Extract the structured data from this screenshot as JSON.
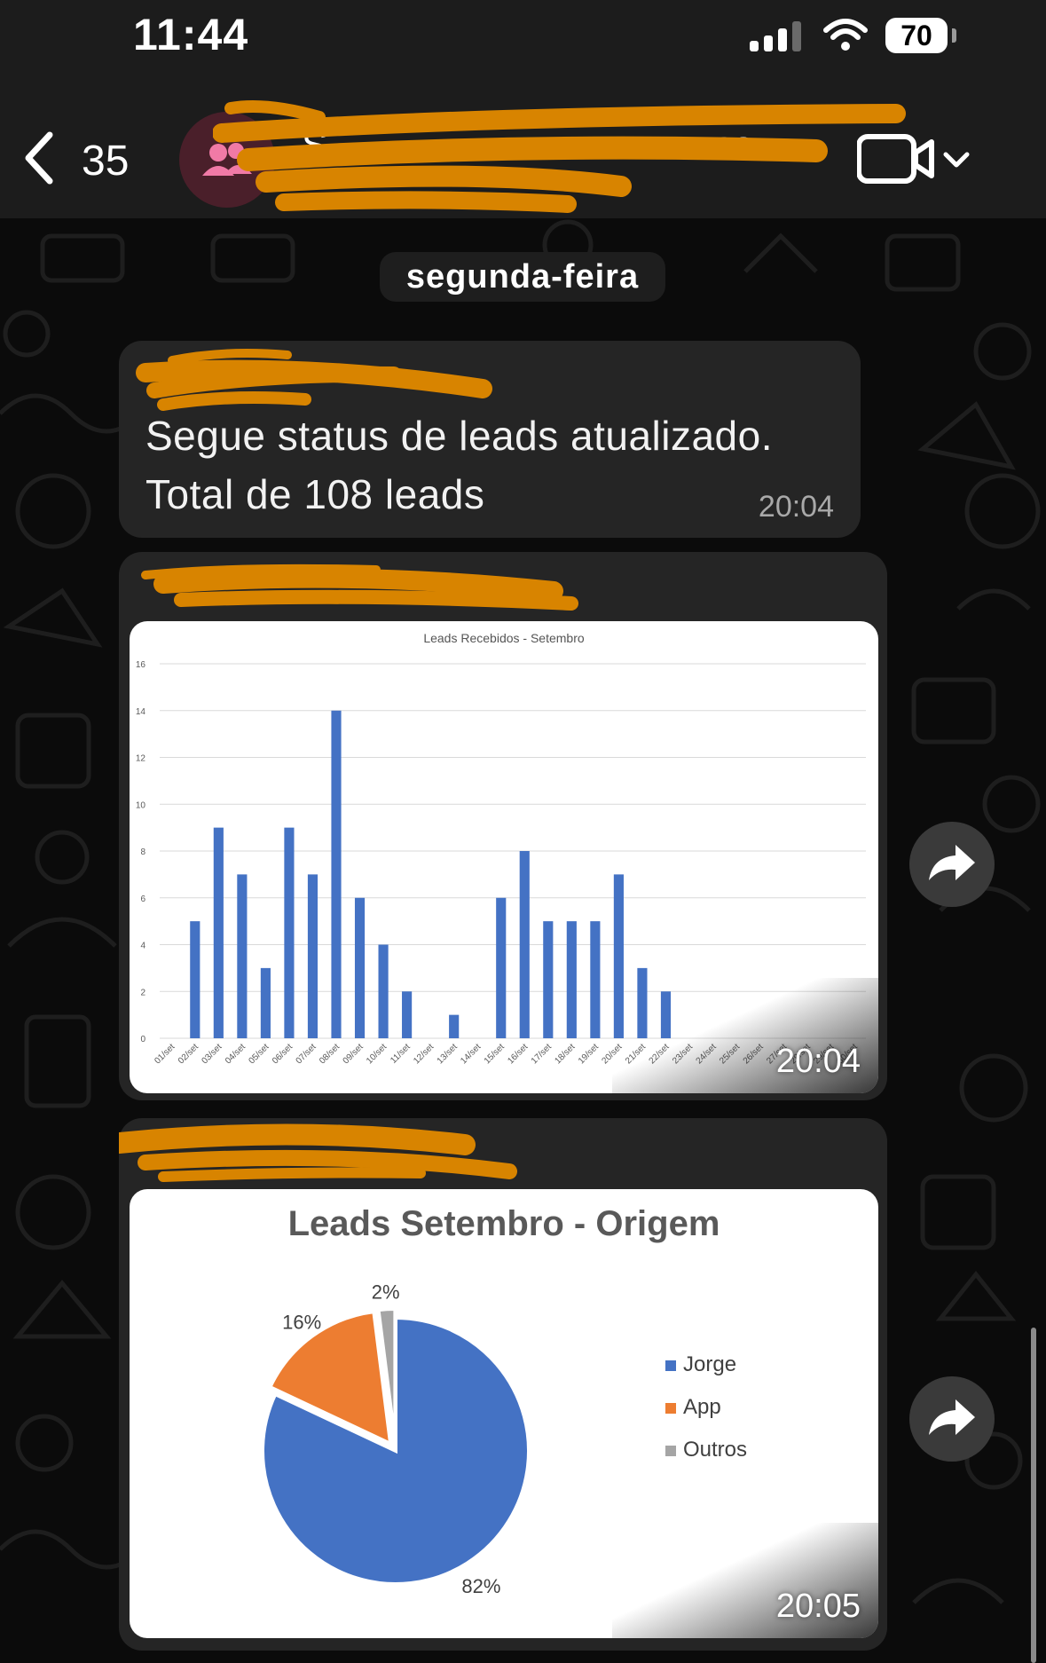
{
  "status_bar": {
    "time": "11:44",
    "battery": "70"
  },
  "header": {
    "back_count": "35"
  },
  "date_divider": "segunda-feira",
  "messages": [
    {
      "lines": [
        "Segue status de leads atualizado.",
        "Total de 108 leads"
      ],
      "time": "20:04"
    },
    {
      "time": "20:04"
    },
    {
      "time": "20:05"
    }
  ],
  "chart_data": [
    {
      "type": "bar",
      "title": "Leads Recebidos - Setembro",
      "categories": [
        "01/set",
        "02/set",
        "03/set",
        "04/set",
        "05/set",
        "06/set",
        "07/set",
        "08/set",
        "09/set",
        "10/set",
        "11/set",
        "12/set",
        "13/set",
        "14/set",
        "15/set",
        "16/set",
        "17/set",
        "18/set",
        "19/set",
        "20/set",
        "21/set",
        "22/set",
        "23/set",
        "24/set",
        "25/set",
        "26/set",
        "27/set",
        "28/set",
        "29/set",
        "30/set"
      ],
      "values": [
        0,
        5,
        9,
        7,
        3,
        9,
        7,
        14,
        6,
        4,
        2,
        0,
        1,
        0,
        6,
        8,
        5,
        5,
        5,
        7,
        3,
        2,
        0,
        0,
        0,
        0,
        0,
        0,
        0,
        0
      ],
      "ylim": [
        0,
        16
      ],
      "yticks": [
        0,
        2,
        4,
        6,
        8,
        10,
        12,
        14,
        16
      ],
      "grid": true,
      "colors": {
        "bar": "#4472C4"
      }
    },
    {
      "type": "pie",
      "title": "Leads Setembro - Origem",
      "slices": [
        {
          "label": "Jorge",
          "value": 82,
          "text": "82%",
          "color": "#4472C4"
        },
        {
          "label": "App",
          "value": 16,
          "text": "16%",
          "color": "#ED7D31"
        },
        {
          "label": "Outros",
          "value": 2,
          "text": "2%",
          "color": "#A5A5A5"
        }
      ],
      "legend": "right"
    }
  ]
}
